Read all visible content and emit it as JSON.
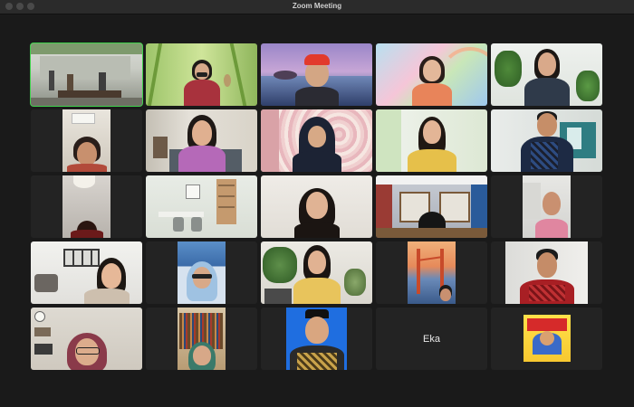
{
  "window": {
    "title": "Zoom Meeting"
  },
  "participants": [
    {
      "name": "",
      "video": true
    },
    {
      "name": "",
      "video": true
    },
    {
      "name": "",
      "video": true
    },
    {
      "name": "",
      "video": true
    },
    {
      "name": "",
      "video": true
    },
    {
      "name": "",
      "video": true
    },
    {
      "name": "",
      "video": true
    },
    {
      "name": "",
      "video": true
    },
    {
      "name": "",
      "video": true
    },
    {
      "name": "",
      "video": true
    },
    {
      "name": "",
      "video": true
    },
    {
      "name": "",
      "video": true
    },
    {
      "name": "",
      "video": true
    },
    {
      "name": "",
      "video": true
    },
    {
      "name": "",
      "video": true
    },
    {
      "name": "",
      "video": true
    },
    {
      "name": "",
      "video": true
    },
    {
      "name": "",
      "video": true
    },
    {
      "name": "",
      "video": true
    },
    {
      "name": "",
      "video": true
    },
    {
      "name": "",
      "video": true
    },
    {
      "name": "",
      "video": true
    },
    {
      "name": "",
      "video": true
    },
    {
      "name": "Eka",
      "video": false
    },
    {
      "name": "",
      "video": true
    }
  ],
  "colors": {
    "active_speaker_border": "#3fd14c",
    "tile_background": "#232323",
    "window_background": "#1a1a1a"
  }
}
